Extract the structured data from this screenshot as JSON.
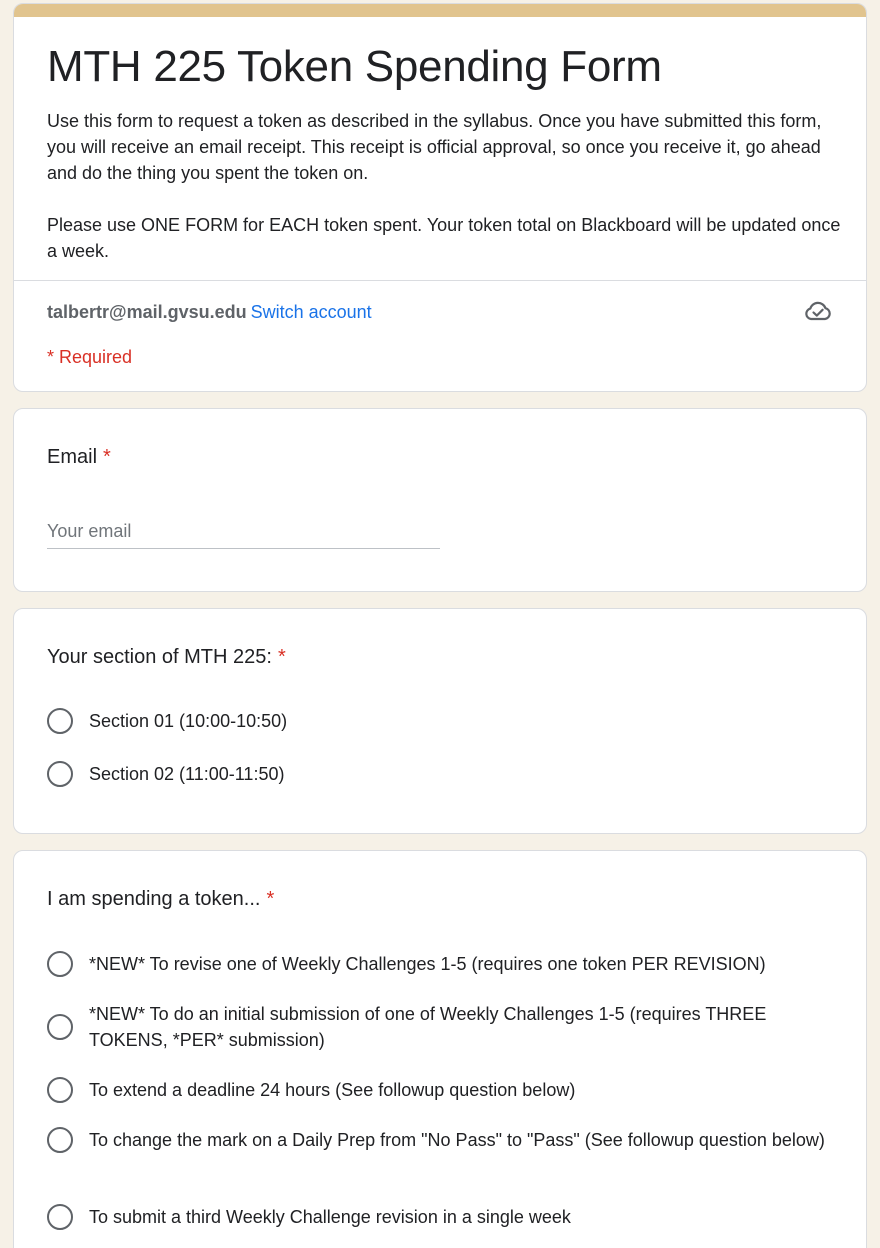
{
  "header": {
    "title": "MTH 225 Token Spending Form",
    "description_1": "Use this form to request a token as described in the syllabus. Once you have submitted this form, you will receive an email receipt. This receipt is official approval, so once you receive it, go ahead and do the thing you spent the token on.",
    "description_2": "Please use ONE FORM for EACH token spent. Your token total on Blackboard will be updated once a week.",
    "account_email": "talbertr@mail.gvsu.edu",
    "switch_account": "Switch account",
    "required_note": "* Required",
    "accent_color": "#e1c48e"
  },
  "email_question": {
    "label": "Email",
    "required_mark": "*",
    "placeholder": "Your email",
    "value": ""
  },
  "section_question": {
    "label": "Your section of MTH 225:",
    "required_mark": "*",
    "options": [
      "Section 01 (10:00-10:50)",
      "Section 02 (11:00-11:50)"
    ]
  },
  "token_question": {
    "label": "I am spending a token...",
    "required_mark": "*",
    "options": [
      "*NEW* To revise one of Weekly Challenges 1-5 (requires one token PER REVISION)",
      "*NEW* To do an initial submission of one of Weekly Challenges 1-5 (requires THREE TOKENS, *PER* submission)",
      "To extend a deadline 24 hours (See followup question below)",
      "To change the mark on a Daily Prep from \"No Pass\" to \"Pass\" (See followup question below)",
      "To submit a third Weekly Challenge revision in a single week"
    ]
  },
  "icons": {
    "cloud": "cloud-check-icon"
  }
}
